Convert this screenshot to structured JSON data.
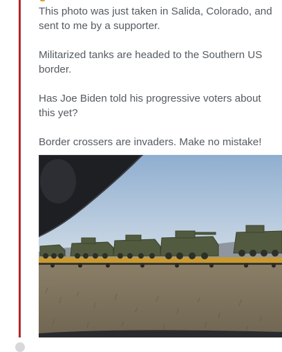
{
  "post": {
    "paragraphs": [
      "This photo was just taken in Salida, Colorado, and sent to me by a supporter.",
      "Militarized tanks are headed to the Southern US border.",
      "Has Joe Biden told his progressive voters about this yet?",
      "Border crossers are invaders. Make no mistake!"
    ]
  },
  "photo": {
    "description_icon": "photo-of-military-vehicles-on-train",
    "sky_color": "#a9c2de",
    "ground_color": "#9a8e76",
    "vehicle_color": "#4e5a3e"
  },
  "colors": {
    "quote_bar": "#b3262b",
    "text": "#555a60"
  }
}
